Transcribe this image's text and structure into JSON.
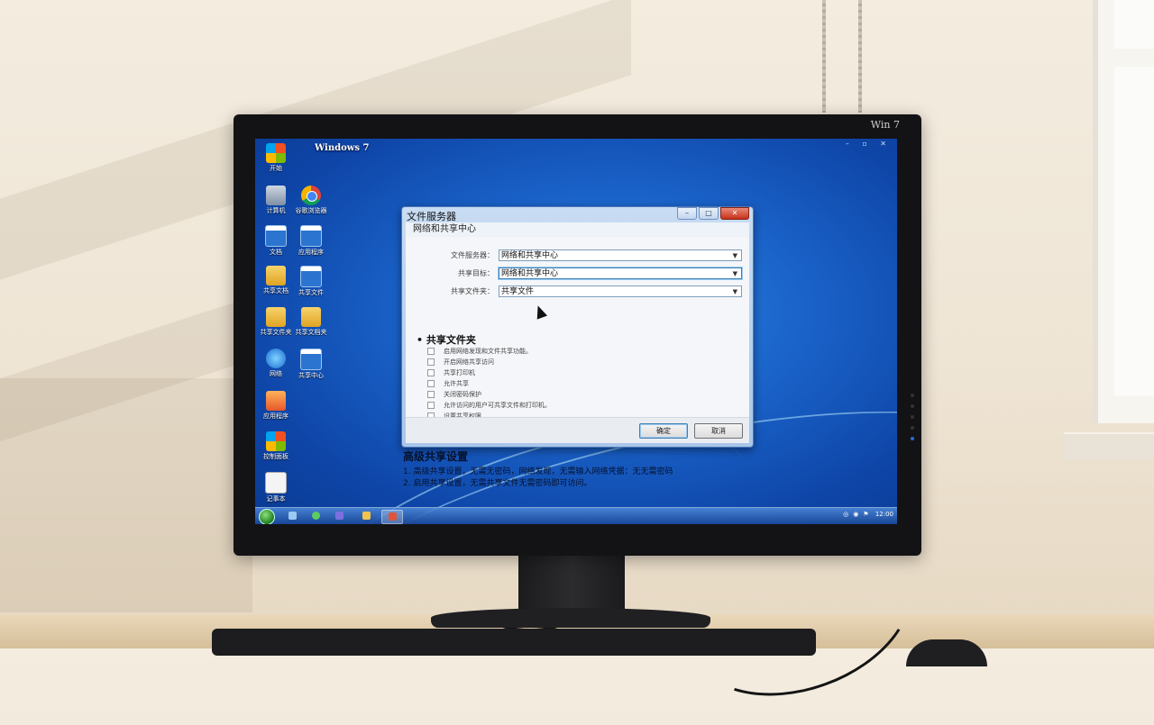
{
  "monitor": {
    "brand": "Win 7"
  },
  "desktop": {
    "logo_text": "Windows 7",
    "icons": [
      {
        "label": "开始",
        "icon": "windows-flag-icon"
      },
      {
        "label": "计算机",
        "icon": "computer-icon"
      },
      {
        "label": "谷歌浏览器",
        "icon": "chrome-icon"
      },
      {
        "label": "文档",
        "icon": "document-icon"
      },
      {
        "label": "应用程序",
        "icon": "document-icon"
      },
      {
        "label": "共享文档",
        "icon": "folder-icon"
      },
      {
        "label": "共享文件",
        "icon": "document-icon"
      },
      {
        "label": "共享文件夹",
        "icon": "folder-icon"
      },
      {
        "label": "共享文档夹",
        "icon": "folder-icon"
      },
      {
        "label": "网络",
        "icon": "network-icon"
      },
      {
        "label": "共享中心",
        "icon": "document-icon"
      },
      {
        "label": "应用程序",
        "icon": "app-icon"
      },
      {
        "label": "控制面板",
        "icon": "windows-logo-icon"
      },
      {
        "label": "记事本",
        "icon": "notepad-icon"
      }
    ]
  },
  "dialog": {
    "title": "文件服务器",
    "subtitle": "网络和共享中心",
    "fields": [
      {
        "label": "文件服务器：",
        "value": "网络和共享中心"
      },
      {
        "label": "共享目标：",
        "value": "网络和共享中心"
      },
      {
        "label": "共享文件夹：",
        "value": "共享文件"
      }
    ],
    "section_title": "共享文件夹",
    "options": [
      "启用网络发现和文件共享功能。",
      "开启网络共享访问",
      "共享打印机",
      "允许共享",
      "关闭密码保护",
      "允许访问的用户可共享文件和打印机。",
      "设置共享权限"
    ],
    "ok_label": "确定",
    "cancel_label": "取消",
    "controls": {
      "minimize": "–",
      "maximize": "□",
      "close": "✕"
    }
  },
  "notes": {
    "heading": "高级共享设置",
    "lines": [
      "1. 高级共享设置，无需无密码，网络发现，无需输入网络凭据：无无需密码",
      "2. 启用共享设置，无需共享文件无需密码即可访问。"
    ]
  },
  "taskbar": {
    "tray_time": "12:00",
    "pinned": [
      "explorer-icon",
      "ie-icon",
      "media-icon",
      "folder-icon",
      "app-icon"
    ]
  }
}
